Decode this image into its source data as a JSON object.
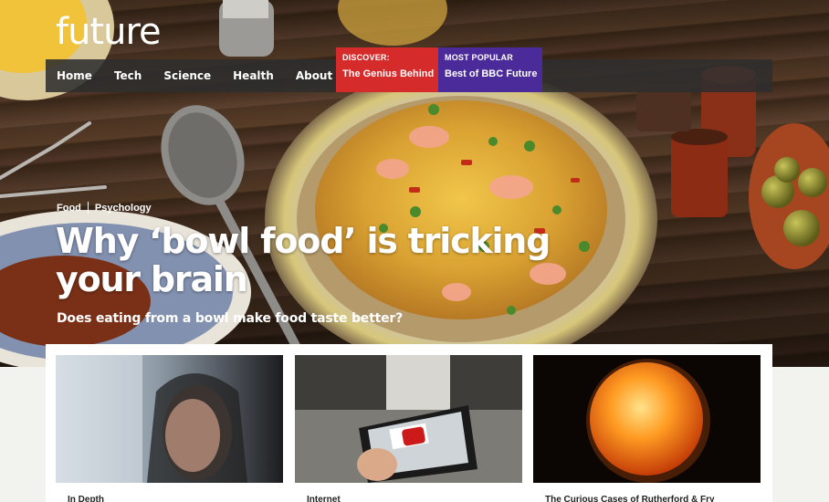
{
  "site": {
    "logo": "future"
  },
  "nav": {
    "items": [
      {
        "label": "Home"
      },
      {
        "label": "Tech"
      },
      {
        "label": "Science"
      },
      {
        "label": "Health"
      },
      {
        "label": "About us"
      }
    ]
  },
  "promos": [
    {
      "kicker": "DISCOVER:",
      "title": "The Genius Behind",
      "color": "#d62b2b"
    },
    {
      "kicker": "MOST POPULAR",
      "title": "Best of BBC Future",
      "color": "#4b2b9a"
    }
  ],
  "article": {
    "tags": [
      "Food",
      "Psychology"
    ],
    "headline": "Why ‘bowl food’ is tricking your brain",
    "subhead": "Does eating from a bowl make food taste better?"
  },
  "cards": [
    {
      "label": "In Depth"
    },
    {
      "label": "Internet"
    },
    {
      "label": "The Curious Cases of Rutherford & Fry"
    }
  ]
}
